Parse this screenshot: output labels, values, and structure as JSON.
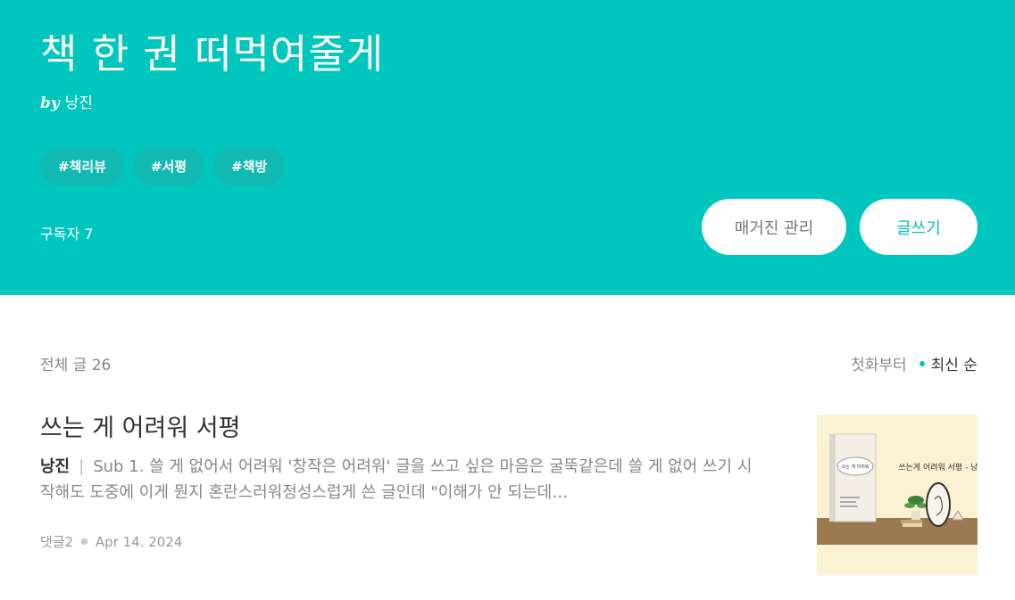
{
  "hero": {
    "title": "책 한 권 떠먹여줄게",
    "by": "by",
    "author": "낭진",
    "tags": [
      "#책리뷰",
      "#서평",
      "#책방"
    ],
    "subscribers": "구독자 7",
    "manage_button": "매거진 관리",
    "write_button": "글쓰기"
  },
  "list": {
    "total": "전체 글 26",
    "sort_first": "첫화부터",
    "sort_latest": "최신 순"
  },
  "post": {
    "title": "쓰는 게 어려워 서평",
    "author": "낭진",
    "separator": "|",
    "excerpt": "Sub 1. 쓸 게 없어서 어려워 '창작은 어려워' 글을 쓰고 싶은 마음은 굴뚝같은데 쓸 게 없어 쓰기 시작해도 도중에 이게 뭔지 혼란스러워정성스럽게 쓴 글인데 \"이해가 안 되는데…",
    "comments": "댓글2",
    "date": "Apr 14. 2024",
    "thumb_text": "쓰는게 어려워 서평 - 낭진",
    "book_title": "쓰는 게 어려워"
  },
  "colors": {
    "accent": "#00c6be",
    "tag_bg": "#11b9b2",
    "thumb_bg": "#fbf1d3",
    "thumb_floor": "#9c7a4f"
  }
}
